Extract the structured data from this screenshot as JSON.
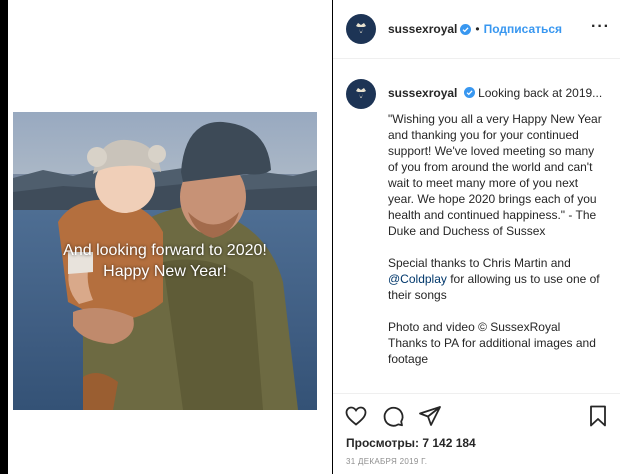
{
  "post": {
    "username": "sussexroyal",
    "follow_label": "Подписаться",
    "separator": "•",
    "video_caption_line1": "And looking forward to 2020!",
    "video_caption_line2": "Happy New Year!"
  },
  "comment": {
    "username": "sussexroyal",
    "preview": "Looking back at 2019...",
    "paragraph1": "\"Wishing you all a very Happy New Year and thanking you for your continued support! We've loved meeting so many of you from around the world and can't wait to meet many more of you next year. We hope 2020 brings each of you health and continued happiness.\" - The Duke and Duchess of Sussex",
    "paragraph2_before": "Special thanks to Chris Martin and ",
    "paragraph2_mention": "@Coldplay",
    "paragraph2_after": " for allowing us to use one of their songs",
    "paragraph3_line1": "Photo and video © SussexRoyal",
    "paragraph3_line2": "Thanks to PA for additional images and footage"
  },
  "footer": {
    "views": "Просмотры: 7 142 184",
    "date": "31 ДЕКАБРЯ 2019 Г."
  },
  "icons": {
    "more": "more-options-icon",
    "like": "heart-icon",
    "comment": "comment-icon",
    "share": "share-icon",
    "save": "bookmark-icon",
    "verified": "verified-badge-icon"
  },
  "colors": {
    "accent": "#3897f0",
    "verified": "#3897f0",
    "avatar_bg": "#1d3455",
    "mention": "#00376b"
  }
}
